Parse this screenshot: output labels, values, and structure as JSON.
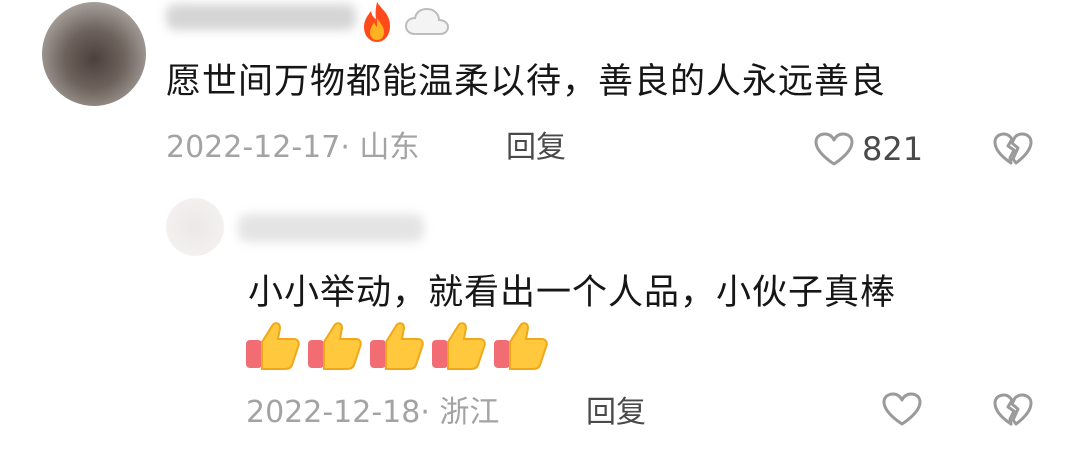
{
  "comments": [
    {
      "text": "愿世间万物都能温柔以待，善良的人永远善良",
      "badges": [
        "fire-icon",
        "cloud-icon"
      ],
      "date_location": "2022-12-17· 山东",
      "reply_label": "回复",
      "likes": "821"
    },
    {
      "text": "小小举动，就看出一个人品，小伙子真棒",
      "emojis": [
        "thumbs-up-icon",
        "thumbs-up-icon",
        "thumbs-up-icon",
        "thumbs-up-icon",
        "thumbs-up-icon"
      ],
      "date_location": "2022-12-18· 浙江",
      "reply_label": "回复"
    }
  ],
  "colors": {
    "text_primary": "#161616",
    "text_meta": "#a3a3a3",
    "text_action": "#4a4a4a",
    "icon_gray": "#9a9a9a"
  }
}
